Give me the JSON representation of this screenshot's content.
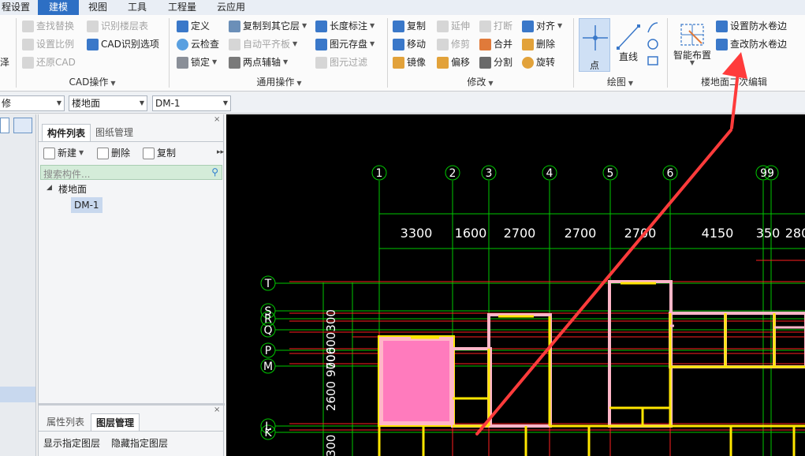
{
  "menu": {
    "items": [
      {
        "label": "程设置",
        "active": false
      },
      {
        "label": "建模",
        "active": true
      },
      {
        "label": "视图",
        "active": false
      },
      {
        "label": "工具",
        "active": false
      },
      {
        "label": "工程量",
        "active": false
      },
      {
        "label": "云应用",
        "active": false
      }
    ]
  },
  "ribbon": {
    "left_stub": "泽",
    "cad_ops": {
      "find_replace": "查找替换",
      "set_scale": "设置比例",
      "restore_cad": "还原CAD",
      "identify_floor_table": "识别楼层表",
      "cad_options": "CAD识别选项",
      "label": "CAD操作"
    },
    "general_ops": {
      "define": "定义",
      "cloud_check": "云检查",
      "lock": "锁定",
      "copy_to_floor": "复制到其它层",
      "auto_level_slab": "自动平齐板",
      "two_point_axis": "两点辅轴",
      "length_dim": "长度标注",
      "save_element": "图元存盘",
      "filter_element": "图元过滤",
      "label": "通用操作"
    },
    "modify": {
      "copy": "复制",
      "move": "移动",
      "mirror": "镜像",
      "extend": "延伸",
      "trim": "修剪",
      "offset": "偏移",
      "break": "打断",
      "merge": "合并",
      "split": "分割",
      "align": "对齐",
      "delete": "删除",
      "rotate": "旋转",
      "label": "修改"
    },
    "draw": {
      "point": "点",
      "line": "直线",
      "label": "绘图"
    },
    "floor_edit": {
      "smart_layout": "智能布置",
      "set_waterproof": "设置防水卷边",
      "edit_waterproof": "查改防水卷边",
      "label": "楼地面二次编辑"
    }
  },
  "toolbar2": {
    "combo1": "修",
    "combo2": "楼地面",
    "combo3": "DM-1"
  },
  "panel": {
    "tab_components": "构件列表",
    "tab_drawings": "图纸管理",
    "btn_new": "新建",
    "btn_delete": "删除",
    "btn_copy": "复制",
    "search_placeholder": "搜索构件...",
    "tree_root": "楼地面",
    "tree_child": "DM-1",
    "tab_properties": "属性列表",
    "tab_layers": "图层管理",
    "show_layer": "显示指定图层",
    "hide_layer": "隐藏指定图层"
  },
  "drawing": {
    "axis_cols": [
      "1",
      "2",
      "3",
      "4",
      "5",
      "6",
      "99"
    ],
    "dimensions": [
      "3300",
      "1600",
      "2700",
      "2700",
      "2700",
      "4150",
      "350",
      "280"
    ],
    "axis_rows": [
      "T",
      "S",
      "R",
      "Q",
      "P",
      "M",
      "L",
      "K"
    ],
    "vertical_dims": [
      "700",
      "2600",
      "300"
    ],
    "stacked_dim_fragment": "900600300",
    "colors": {
      "background": "#000000",
      "axis_line": "#00c800",
      "grid_red": "#ff2020",
      "wall_yellow": "#ffe600",
      "wall_fill": "#ffb6c8",
      "slab_magenta": "#ff7bbd",
      "arrow": "#ff3b3b"
    }
  }
}
